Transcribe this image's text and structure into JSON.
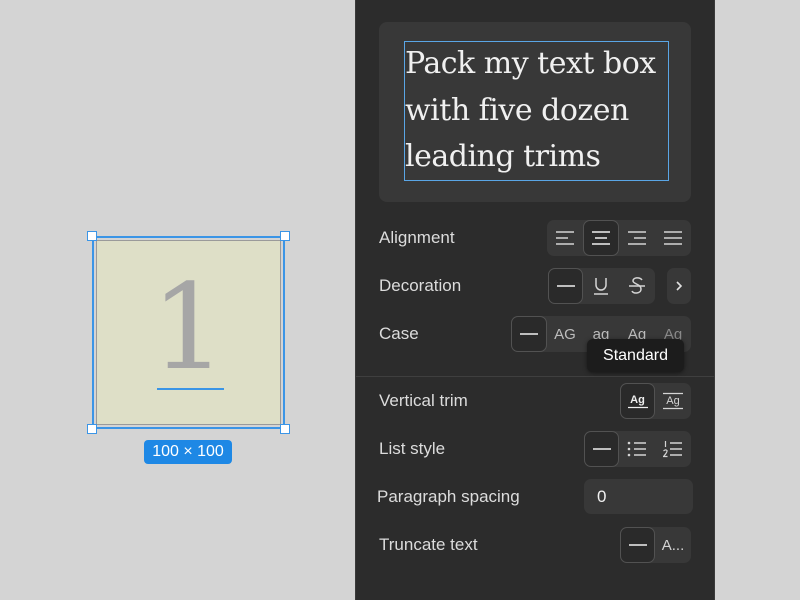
{
  "canvas": {
    "frame_digit": "1",
    "size_label": "100 × 100"
  },
  "panel": {
    "preview": {
      "lines": [
        "Pack my text box",
        "with five dozen",
        "leading trims"
      ]
    },
    "alignment": {
      "label": "Alignment",
      "options": [
        "align-left",
        "align-center",
        "align-right",
        "justify"
      ],
      "selected": "align-center"
    },
    "decoration": {
      "label": "Decoration",
      "options": [
        "none",
        "underline",
        "strikethrough"
      ],
      "selected": "none",
      "more_icon": "chevron-right-icon"
    },
    "case": {
      "label": "Case",
      "options": [
        "AG",
        "ag",
        "Ag",
        "Ag"
      ],
      "selected": "none"
    },
    "tooltip": "Standard",
    "vertical_trim": {
      "label": "Vertical trim",
      "options": [
        "Ag",
        "Ag"
      ],
      "selected": 0
    },
    "list_style": {
      "label": "List style",
      "options": [
        "none",
        "bulleted-list",
        "numbered-list"
      ],
      "selected": "none"
    },
    "paragraph_spacing": {
      "label": "Paragraph spacing",
      "value": "0"
    },
    "truncate_text": {
      "label": "Truncate text",
      "options": [
        "none",
        "A..."
      ],
      "selected": "none"
    },
    "colors": {
      "selection": "#3b95e6",
      "badge": "#1e88e5",
      "panel_bg": "#2c2c2c"
    }
  }
}
